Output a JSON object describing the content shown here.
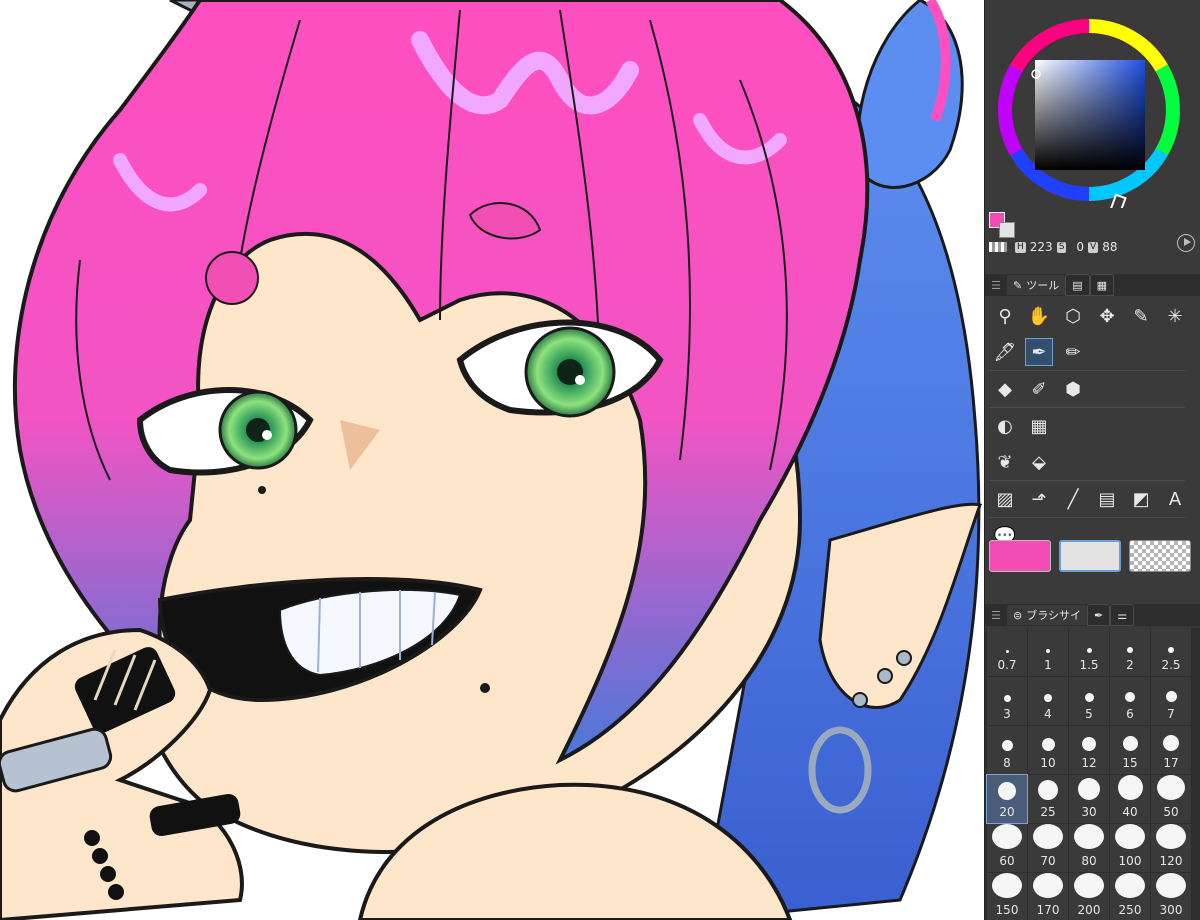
{
  "panel": {
    "color": {
      "main_color": "#f54bb5",
      "sub_color": "#e3e3e3",
      "h_label": "H",
      "h_value": "223",
      "s_label": "S",
      "s_value": "0",
      "v_label": "V",
      "v_value": "88"
    },
    "tools_panel": {
      "tab_label": "ツール",
      "tools": [
        {
          "row": 1,
          "items": [
            {
              "icon": "zoom-icon",
              "glyph": "⚲"
            },
            {
              "icon": "hand-icon",
              "glyph": "✋"
            },
            {
              "icon": "object-3d-icon",
              "glyph": "⬡"
            },
            {
              "icon": "move-icon",
              "glyph": "✥"
            },
            {
              "icon": "lasso-select-icon",
              "glyph": "✎"
            },
            {
              "icon": "auto-select-icon",
              "glyph": "✳"
            }
          ]
        },
        {
          "row": 2,
          "items": [
            {
              "icon": "eyedropper-icon",
              "glyph": "🖋"
            },
            {
              "icon": "pen-icon",
              "glyph": "✒",
              "active": true
            },
            {
              "icon": "pencil-icon",
              "glyph": "✏"
            }
          ]
        },
        {
          "row": 3,
          "items": [
            {
              "icon": "eraser-icon",
              "glyph": "◆"
            },
            {
              "icon": "blend-icon",
              "glyph": "✐"
            },
            {
              "icon": "fill-icon",
              "glyph": "⬢"
            }
          ]
        },
        {
          "row": 4,
          "items": [
            {
              "icon": "gradient-decor-icon",
              "glyph": "◐"
            },
            {
              "icon": "frame-border-icon",
              "glyph": "▦"
            }
          ]
        },
        {
          "row": 5,
          "items": [
            {
              "icon": "decoration-icon",
              "glyph": "❦"
            },
            {
              "icon": "bucket-icon",
              "glyph": "⬙"
            }
          ]
        },
        {
          "row": 6,
          "items": [
            {
              "icon": "gradient-icon",
              "glyph": "▨"
            },
            {
              "icon": "operation-icon",
              "glyph": "⬏"
            },
            {
              "icon": "line-icon",
              "glyph": "╱"
            },
            {
              "icon": "ruler-icon",
              "glyph": "▤"
            },
            {
              "icon": "figure-icon",
              "glyph": "◩"
            },
            {
              "icon": "text-icon",
              "glyph": "A"
            }
          ]
        },
        {
          "row": 7,
          "items": [
            {
              "icon": "balloon-icon",
              "glyph": "💬"
            }
          ]
        }
      ]
    },
    "brush_panel": {
      "tab_label": "ブラシサイ",
      "sizes": [
        "0.7",
        "1",
        "1.5",
        "2",
        "2.5",
        "3",
        "4",
        "5",
        "6",
        "7",
        "8",
        "10",
        "12",
        "15",
        "17",
        "20",
        "25",
        "30",
        "40",
        "50",
        "60",
        "70",
        "80",
        "100",
        "120",
        "150",
        "170",
        "200",
        "250",
        "300"
      ],
      "selected": "20"
    }
  }
}
